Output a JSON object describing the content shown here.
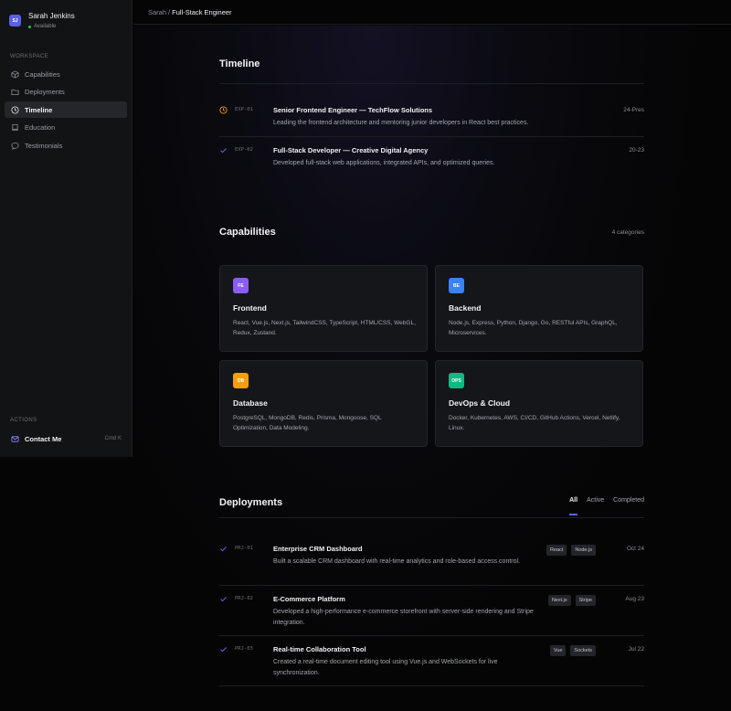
{
  "profile": {
    "initials": "SJ",
    "name": "Sarah Jenkins",
    "status": "Available"
  },
  "sidebar": {
    "workspace_label": "WORKSPACE",
    "items": [
      {
        "label": "Capabilities",
        "icon": "box-icon"
      },
      {
        "label": "Deployments",
        "icon": "folder-icon"
      },
      {
        "label": "Timeline",
        "icon": "clock-icon",
        "active": true
      },
      {
        "label": "Education",
        "icon": "book-icon"
      },
      {
        "label": "Testimonials",
        "icon": "chat-icon"
      }
    ],
    "actions_label": "ACTIONS",
    "contact": {
      "label": "Contact Me",
      "shortcut": "Cmd K",
      "icon": "mail-icon"
    }
  },
  "breadcrumb": {
    "parent": "Sarah",
    "separator": "/",
    "current": "Full-Stack Engineer"
  },
  "timeline": {
    "title": "Timeline",
    "items": [
      {
        "code": "EXP-01",
        "title": "Senior Frontend Engineer — TechFlow Solutions",
        "desc": "Leading the frontend architecture and mentoring junior developers in React best practices.",
        "period": "24-Pres",
        "status": "in-progress",
        "icon": "clock-icon"
      },
      {
        "code": "EXP-02",
        "title": "Full-Stack Developer — Creative Digital Agency",
        "desc": "Developed full-stack web applications, integrated APIs, and optimized queries.",
        "period": "20-23",
        "status": "done",
        "icon": "check-icon"
      }
    ]
  },
  "capabilities": {
    "title": "Capabilities",
    "count": "4 categories",
    "cards": [
      {
        "badge": "FE",
        "badge_color": "#8b5cf6",
        "title": "Frontend",
        "desc": "React, Vue.js, Next.js, TailwindCSS, TypeScript, HTML/CSS, WebGL, Redux, Zustand."
      },
      {
        "badge": "BE",
        "badge_color": "#3b82f6",
        "title": "Backend",
        "desc": "Node.js, Express, Python, Django, Go, RESTful APIs, GraphQL, Microservices."
      },
      {
        "badge": "DB",
        "badge_color": "#f59e0b",
        "title": "Database",
        "desc": "PostgreSQL, MongoDB, Redis, Prisma, Mongoose, SQL Optimization, Data Modeling."
      },
      {
        "badge": "OPS",
        "badge_color": "#10b981",
        "title": "DevOps & Cloud",
        "desc": "Docker, Kubernetes, AWS, CI/CD, GitHub Actions, Vercel, Netlify, Linux."
      }
    ]
  },
  "deployments": {
    "title": "Deployments",
    "tabs": [
      {
        "label": "All",
        "active": true
      },
      {
        "label": "Active"
      },
      {
        "label": "Completed"
      }
    ],
    "items": [
      {
        "code": "PRJ-01",
        "title": "Enterprise CRM Dashboard",
        "desc": "Built a scalable CRM dashboard with real-time analytics and role-based access control.",
        "tags": [
          "React",
          "Node.js"
        ],
        "date": "Oct 24"
      },
      {
        "code": "PRJ-02",
        "title": "E-Commerce Platform",
        "desc": "Developed a high-performance e-commerce storefront with server-side rendering and Stripe integration.",
        "tags": [
          "Next.js",
          "Stripe"
        ],
        "date": "Aug 23"
      },
      {
        "code": "PRJ-03",
        "title": "Real-time Collaboration Tool",
        "desc": "Created a real-time document editing tool using Vue.js and WebSockets for live synchronization.",
        "tags": [
          "Vue",
          "Sockets"
        ],
        "date": "Jul 22"
      }
    ]
  },
  "colors": {
    "accent": "#5b5fe6",
    "in_progress": "#f59e0b",
    "success": "#22c55e",
    "check": "#6366f1"
  }
}
